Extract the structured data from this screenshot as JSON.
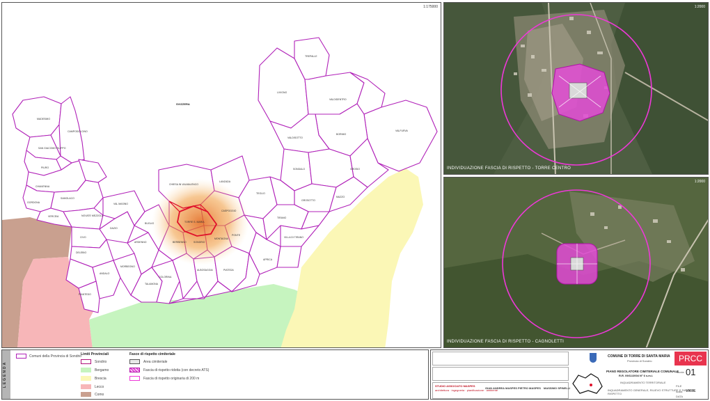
{
  "map": {
    "scale_label": "1:175000",
    "region_label": "SVIZZERA",
    "colors": {
      "sondrio_border": "#b020b8",
      "bergamo": "#c6f4bf",
      "brescia": "#fbf7b6",
      "lecco": "#f7b6b8",
      "como": "#c9a08f",
      "buffer_orange": "#f08020",
      "highlight_red": "#e0102a"
    },
    "municipalities": [
      "Livigno",
      "Valdidentro",
      "Valdisotto",
      "Bormio",
      "Sondalo",
      "Tirano",
      "Grosio",
      "Madesimo",
      "Campodolcino",
      "Chiavenna",
      "Novate Mezzola",
      "Morbegno",
      "Talamona",
      "Ardenno",
      "Berbenno",
      "Sondrio",
      "Torre di Santa Maria",
      "Chiesa in Valmalenco",
      "Lanzada",
      "Caspoggio",
      "Spriana",
      "Montagna",
      "Ponte in Valtellina",
      "Teglio",
      "Aprica",
      "Villa di Tirano",
      "Sernio",
      "Lovero",
      "Tovo",
      "Mazzo",
      "Grosotto",
      "Piateda",
      "Albosaggia",
      "Faedo",
      "Caiolo",
      "Cedrasco",
      "Fusine",
      "Colorina",
      "Forcola",
      "Buglio",
      "Val Masino",
      "Cino",
      "Mantello",
      "Cosio",
      "Traona",
      "Dazio",
      "Civo",
      "Mello",
      "Delebio",
      "Piantedo",
      "Andalo",
      "Rogolo",
      "Verceia",
      "Samolaco",
      "Gordona",
      "Mese",
      "Prata",
      "Piuro",
      "Villa di Chiavenna",
      "San Giacomo Filippo"
    ]
  },
  "photos": {
    "top": {
      "caption": "INDIVIDUAZIONE FASCIA DI RISPETTO - TORRE CENTRO",
      "scale": "1:2000"
    },
    "bottom": {
      "caption": "INDIVIDUAZIONE FASCIA DI RISPETTO - CAGNOLETTI",
      "scale": "1:2000"
    }
  },
  "legend": {
    "side_label": "LEGENDA",
    "comuni": "Comuni della Provincia di Sondrio",
    "limiti_title": "Limiti Provinciali",
    "limiti": [
      "Sondrio",
      "Bergamo",
      "Brescia",
      "Lecco",
      "Como"
    ],
    "fasce_title": "Fasce di rispetto cimiteriale",
    "fasce": [
      "Area cimiteriale",
      "Fascia di rispetto ridotta (con decreto ATS)",
      "Fascia di rispetto originaria di 200 m"
    ]
  },
  "titleblock": {
    "comune": "COMUNE DI TORRE DI SANTA MARIA",
    "provincia": "Provincia di Sondrio",
    "piano": "PIANO REGOLATORE CIMITERIALE COMUNALE",
    "legge": "R.R. 09/11/2004 N° 6 s.m.i.",
    "code": "PRCC",
    "tavola_label": "Tavola",
    "tavola": "01",
    "scala_label": "scala",
    "scala": "VARIE",
    "title1": "INQUADRAMENTO TERRITORIALE",
    "title2": "INQUADRAMENTO GENERALE, RILIEVO STRUTTURE E FASCE DI RISPETTO",
    "firm": "STUDIO ASSOCIATO MASPES",
    "firm_sub": "architettura · ingegneria · pianificazione · ambiente",
    "person1": "GIAN ANDREA MASPES",
    "person2": "PIETRO MASPES",
    "person3": "MASSIMO SPINELLI",
    "file_label": "FILE",
    "data_label": "DATA"
  }
}
